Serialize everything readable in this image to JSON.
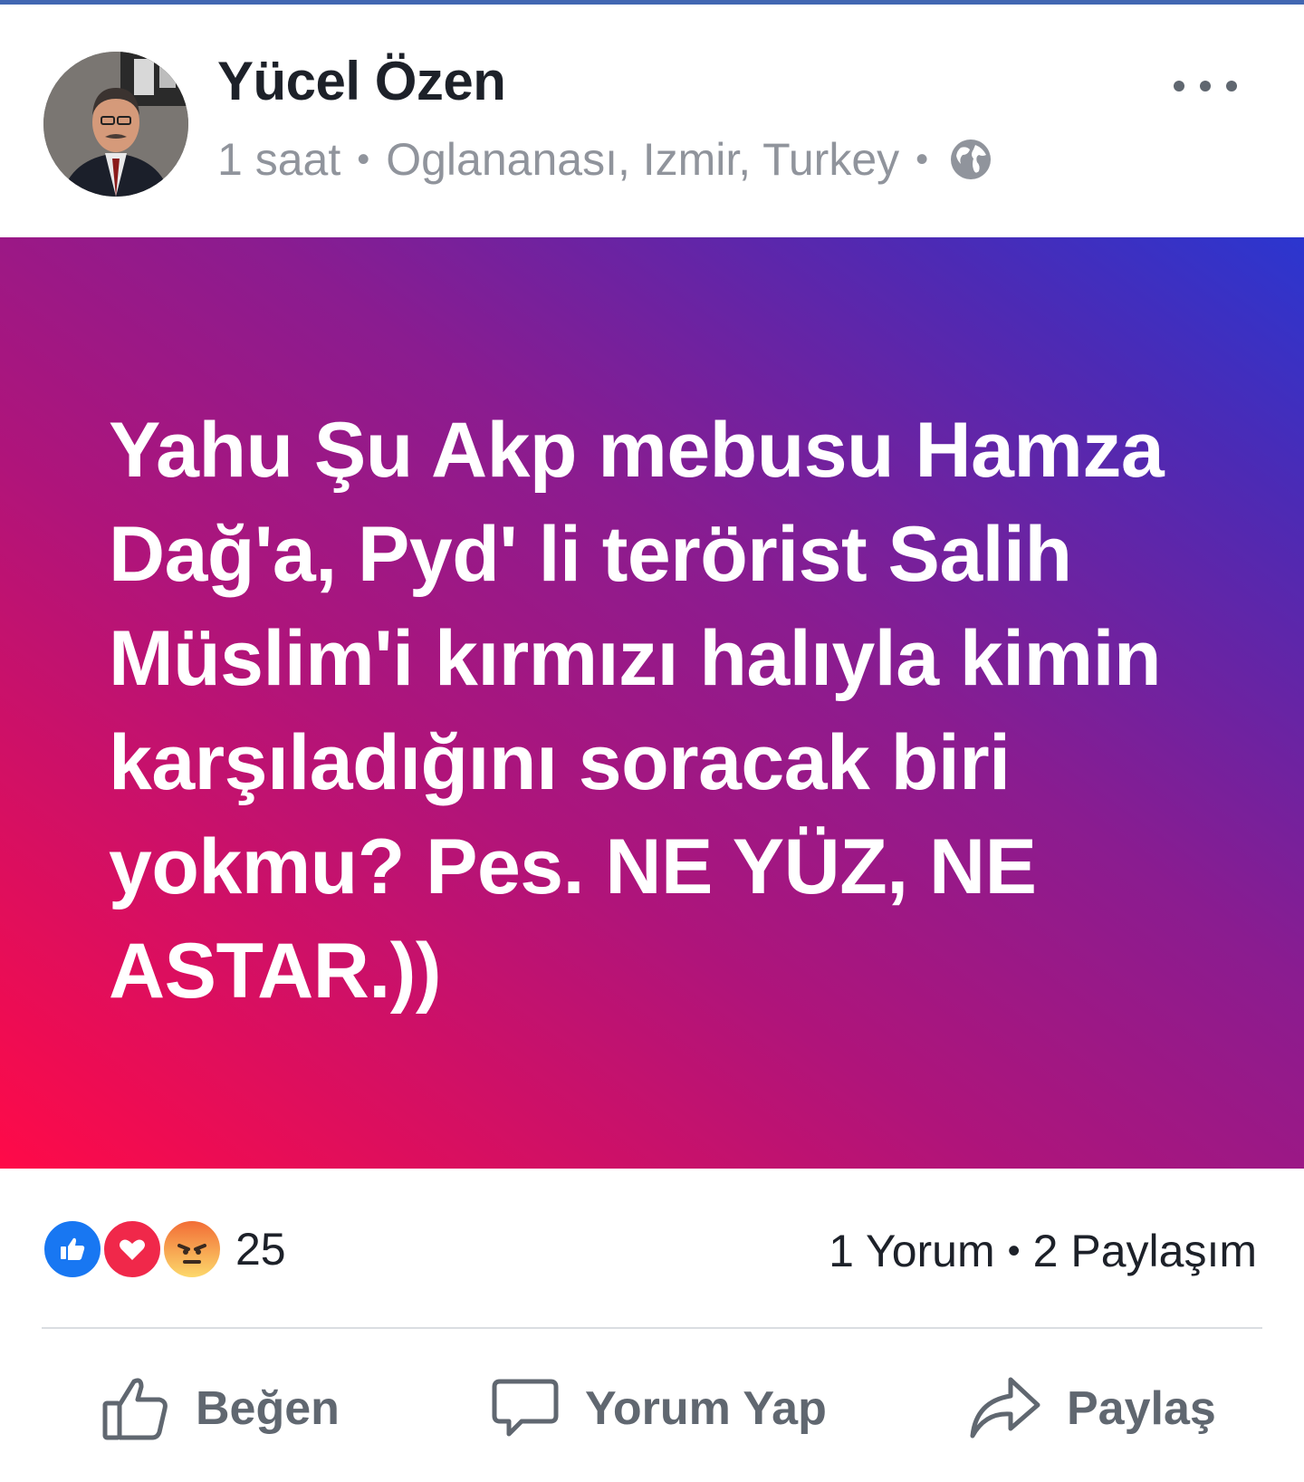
{
  "post": {
    "author": "Yücel Özen",
    "time": "1 saat",
    "location": "Oglananası, Izmir, Turkey",
    "separator": "•",
    "privacy_icon": "globe-icon",
    "text": "Yahu Şu Akp mebusu Hamza Dağ'a, Pyd' li terörist Salih Müslim'i kırmızı halıyla kimin karşıladığını soracak biri yokmu? Pes. NE YÜZ, NE ASTAR.))"
  },
  "stats": {
    "reaction_icons": [
      "like-icon",
      "love-icon",
      "angry-icon"
    ],
    "reaction_count": "25",
    "comments": "1 Yorum",
    "separator": "•",
    "shares": "2 Paylaşım"
  },
  "actions": {
    "like_label": "Beğen",
    "comment_label": "Yorum Yap",
    "share_label": "Paylaş"
  },
  "colors": {
    "gradient_start": "#ff0a48",
    "gradient_end": "#2b36cf",
    "text_primary": "#1d2129",
    "text_secondary": "#90949c",
    "action_gray": "#606770"
  }
}
